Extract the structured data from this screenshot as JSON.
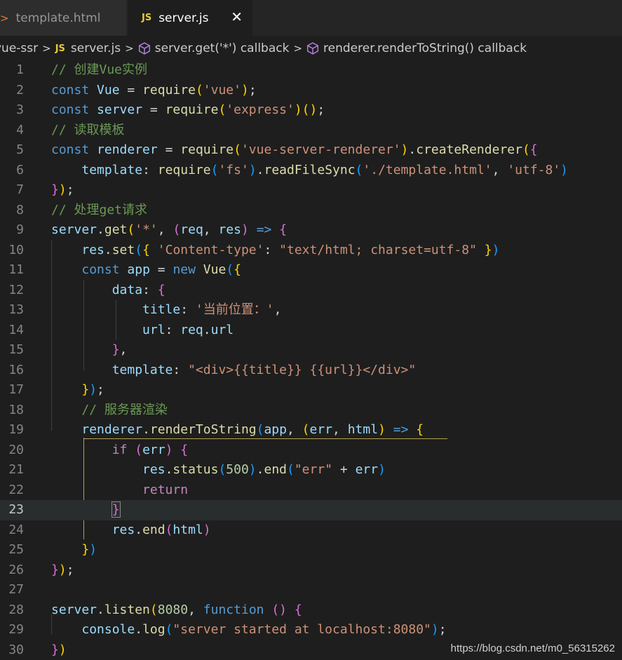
{
  "tabs": [
    {
      "label": "template.html"
    },
    {
      "label": "server.js",
      "badge": "JS",
      "close": "✕"
    }
  ],
  "breadcrumb": {
    "items": [
      "vue-ssr",
      "server.js",
      "server.get('*') callback",
      "renderer.renderToString() callback"
    ],
    "js_badge": "JS"
  },
  "editor": {
    "line_numbers": [
      "1",
      "2",
      "3",
      "4",
      "5",
      "6",
      "7",
      "8",
      "9",
      "10",
      "11",
      "12",
      "13",
      "14",
      "15",
      "16",
      "17",
      "18",
      "19",
      "20",
      "21",
      "22",
      "23",
      "24",
      "25",
      "26",
      "27",
      "28",
      "29",
      "30"
    ],
    "current_line": "23"
  },
  "watermark": "https://blog.csdn.net/m0_56315262",
  "colors": {
    "keyword": "#569cd6",
    "string": "#ce9178",
    "comment": "#6a9955",
    "variable": "#9cdcfe",
    "function": "#dcdcaa"
  }
}
